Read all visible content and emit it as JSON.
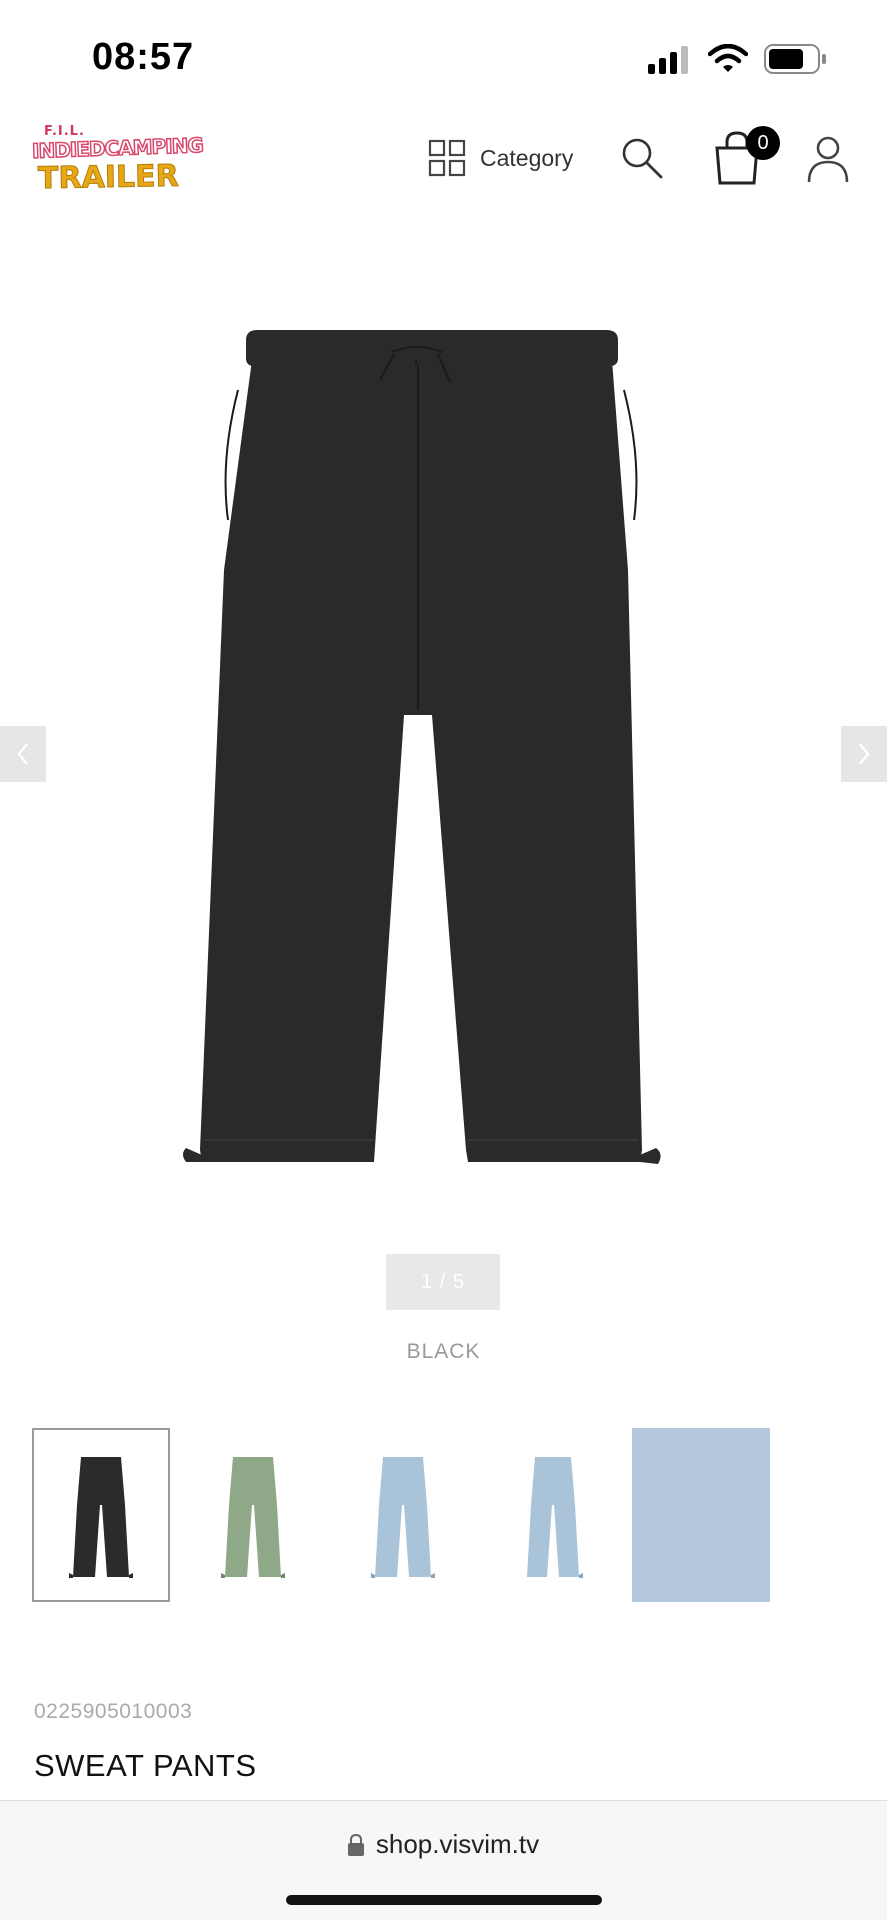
{
  "status_bar": {
    "time": "08:57",
    "icons": [
      "signal-icon",
      "wifi-icon",
      "battery-icon"
    ]
  },
  "header": {
    "logo": {
      "small_text": "F.I.L.",
      "line1": "INDIEDCAMPING",
      "line2": "TRAILER"
    },
    "category_label": "Category",
    "cart_count": "0",
    "icons": [
      "grid-icon",
      "search-icon",
      "shopping-bag-icon",
      "user-icon"
    ]
  },
  "gallery": {
    "pager": "1 / 5",
    "color_name": "BLACK",
    "nav_icons": [
      "chevron-left-icon",
      "chevron-right-icon"
    ],
    "thumbnails": [
      {
        "color": "#2b2b2b",
        "kind": "pants",
        "active": true
      },
      {
        "color": "#8fa888",
        "kind": "pants",
        "active": false
      },
      {
        "color": "#a9c3d8",
        "kind": "pants",
        "active": false
      },
      {
        "color": "#a9c3d8",
        "kind": "pants-back",
        "active": false
      },
      {
        "color": "#b3c8dc",
        "kind": "swatch",
        "active": false
      }
    ]
  },
  "product": {
    "sku": "0225905010003",
    "name": "SWEAT PANTS"
  },
  "browser": {
    "url": "shop.visvim.tv"
  },
  "colors": {
    "pants_main": "#2a2a2a",
    "pager_bg": "#e8e8e8",
    "muted_text": "#999999"
  }
}
